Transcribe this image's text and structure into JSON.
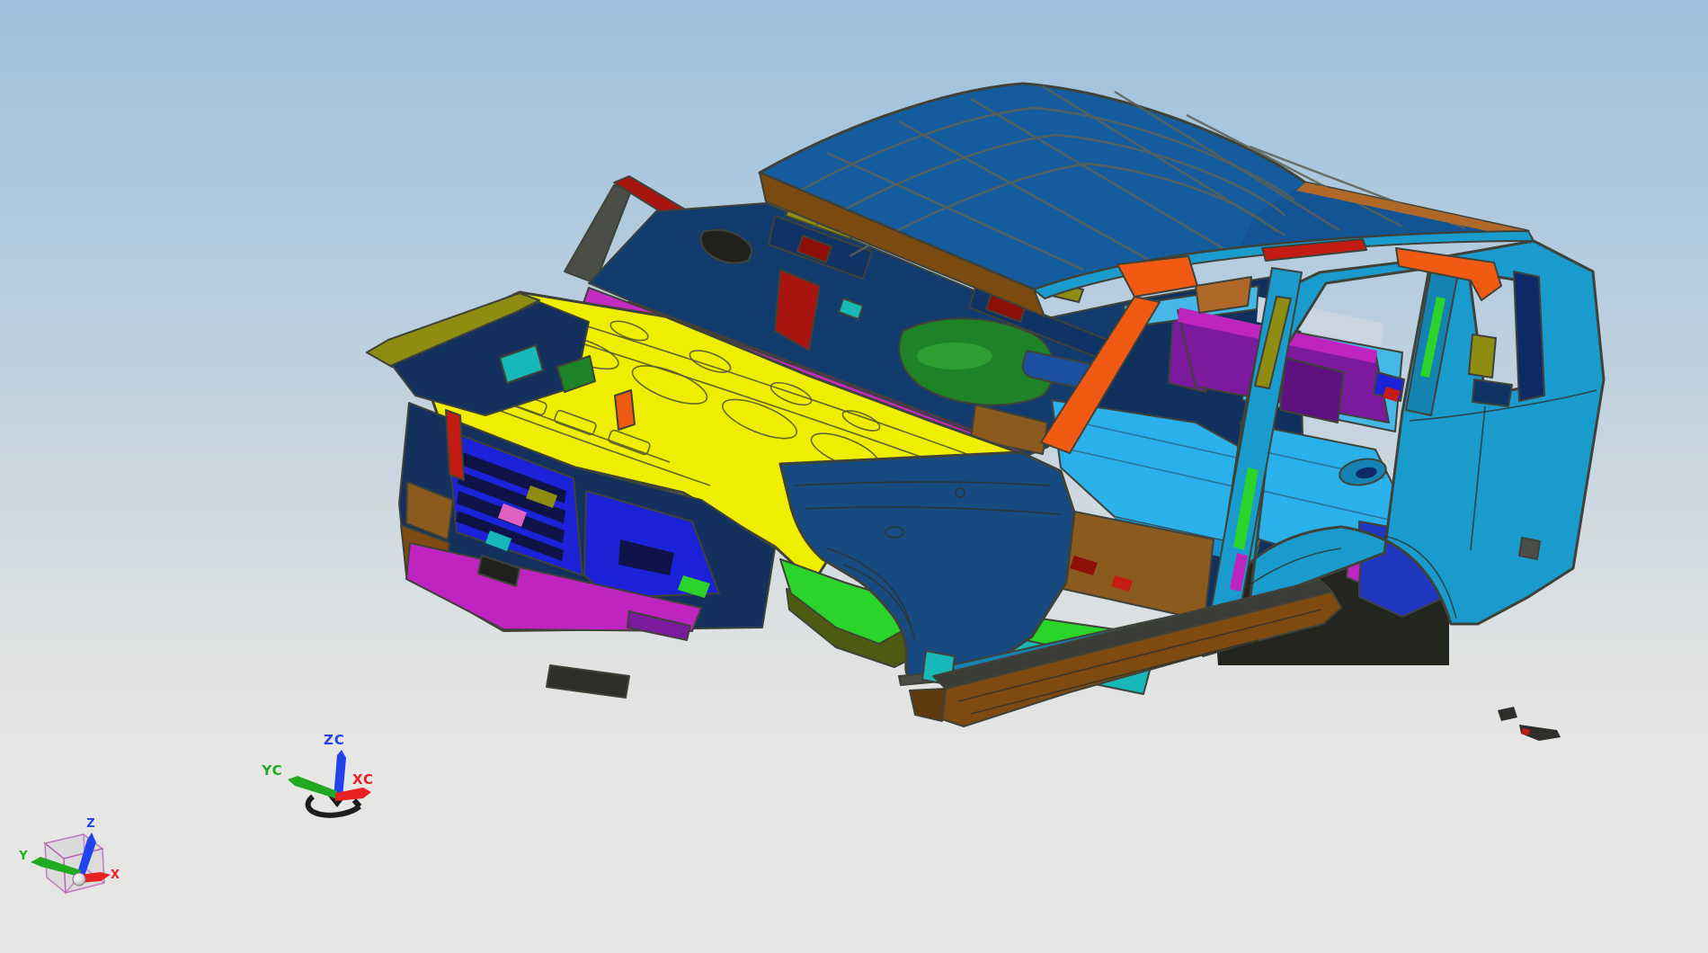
{
  "background": {
    "top": "#9cc0de",
    "middle": "#c9d6e1",
    "bottom": "#e6e6e4"
  },
  "triads": {
    "wcs": {
      "z": "ZC",
      "y": "YC",
      "x": "XC",
      "z_color": "#2143ee",
      "y_color": "#21aa21",
      "x_color": "#e82222",
      "handle_color": "#1d1d1d"
    },
    "absolute": {
      "z": "Z",
      "y": "Y",
      "x": "X",
      "z_color": "#2143ee",
      "y_color": "#21aa21",
      "x_color": "#e82222",
      "cube_edge_color": "#c05fc0",
      "cube_face_color": "#d9d9d9",
      "origin_color": "#e9e9e9"
    }
  },
  "palette": {
    "edge": "#3f4238",
    "roof_blue": "#155c9e",
    "roof_blue_dark": "#104e8c",
    "header_brown": "#7a4a10",
    "rail_red": "#a81410",
    "copper": "#b06828",
    "pillar_orange": "#f05a12",
    "olive": "#8f8c12",
    "visor_navy": "#0e3364",
    "interior_navy": "#123c6e",
    "door_inner_navy": "#10305e",
    "deep_navy": "#0d2a66",
    "dark_red": "#8e1008",
    "bright_red": "#c41c12",
    "engine_green": "#1e8226",
    "engine_green_hi": "#35a838",
    "bright_green": "#2ad42a",
    "green_edge_dark": "#4c5a12",
    "ip_blue": "#1b4fa0",
    "cowl_magenta": "#c22cc2",
    "purple": "#7c1a9e",
    "dark_purple": "#5e1280",
    "magenta": "#c024c0",
    "pink": "#e060c0",
    "hood_yellow": "#f0ee00",
    "grille_blue": "#1b22d8",
    "grille_slot": "#0e1448",
    "clip_navy": "#14315e",
    "brown": "#8a5a1e",
    "rocker_brown": "#7d4a12",
    "rocker_brown_dark": "#5e3a0e",
    "rocker_top_gray": "#3a3d35",
    "fender_navy": "#174a80",
    "body_cyan": "#1a9bce",
    "body_cyan_dark": "#1583b2",
    "body_cyan_light": "#45b8e8",
    "floor_ltblue": "#2ab0ea",
    "floor_ltblue_dark": "#1890cc",
    "teal": "#17b8b8",
    "wheelhouse_blue": "#2038c0",
    "arch_dark": "#23261f",
    "window_bg": "#c9d6e2",
    "gray_part": "#4a4e46",
    "dark_part": "#2e2e2a",
    "black_part": "#20201c"
  }
}
